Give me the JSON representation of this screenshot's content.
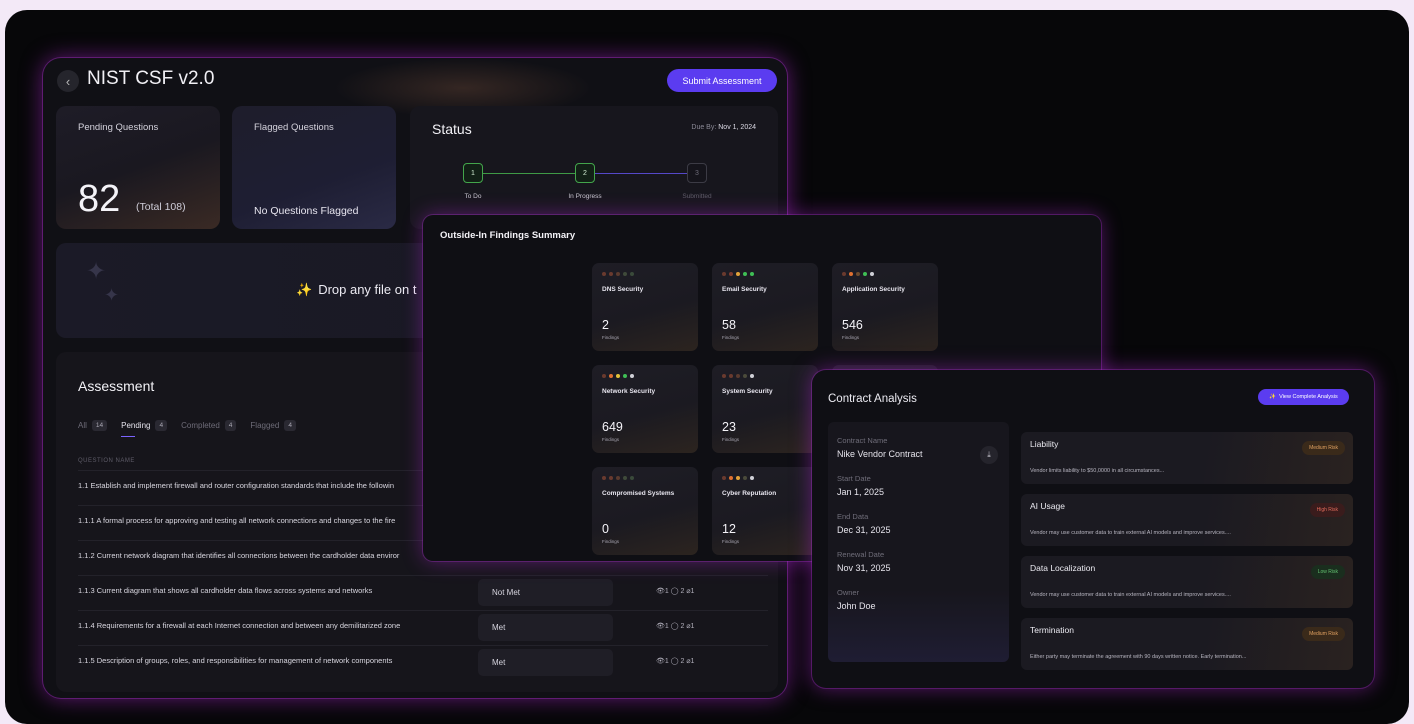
{
  "nist": {
    "title": "NIST CSF v2.0",
    "submit_label": "Submit Assessment",
    "pending": {
      "label": "Pending Questions",
      "value": "82",
      "total": "(Total 108)"
    },
    "flagged": {
      "label": "Flagged Questions",
      "text": "No Questions Flagged"
    },
    "status": {
      "title": "Status",
      "due_label": "Due By:",
      "due_date": "Nov 1, 2024",
      "steps": [
        {
          "num": "1",
          "label": "To Do"
        },
        {
          "num": "2",
          "label": "In Progress"
        },
        {
          "num": "3",
          "label": "Submitted"
        }
      ]
    },
    "drop_text": "Drop any file on t",
    "assessment": {
      "title": "Assessment",
      "tabs": [
        {
          "label": "All",
          "count": "14"
        },
        {
          "label": "Pending",
          "count": "4"
        },
        {
          "label": "Completed",
          "count": "4"
        },
        {
          "label": "Flagged",
          "count": "4"
        }
      ],
      "column_header": "QUESTION NAME",
      "rows": [
        {
          "question": "1.1 Establish and implement firewall and router configuration standards that include the followin",
          "status": "",
          "meta": ""
        },
        {
          "question": "1.1.1 A formal process for approving and testing all network connections and changes to the fire",
          "status": "",
          "meta": ""
        },
        {
          "question": "1.1.2 Current network diagram that identifies all connections between the cardholder data enviror",
          "status": "",
          "meta": ""
        },
        {
          "question": "1.1.3 Current diagram that shows all cardholder data flows across systems and networks",
          "status": "Not Met",
          "meta": "👁1  ◯ 2  ⌀1"
        },
        {
          "question": "1.1.4 Requirements for a firewall at each Internet connection and between any demilitarized zone",
          "status": "Met",
          "meta": "👁1  ◯ 2  ⌀1"
        },
        {
          "question": "1.1.5 Description of groups, roles, and responsibilities for management of network components",
          "status": "Met",
          "meta": "👁1  ◯ 2  ⌀1"
        }
      ]
    }
  },
  "findings": {
    "title": "Outside-In Findings Summary",
    "unit": "Findings",
    "cards": [
      {
        "name": "DNS Security",
        "value": "2",
        "dots": [
          "#6a3a2e",
          "#6a3a2e",
          "#5a3a2e",
          "#3f4a3a",
          "#3a4a3a"
        ]
      },
      {
        "name": "Email Security",
        "value": "58",
        "dots": [
          "#6a3a2e",
          "#7a3a30",
          "#e2a23a",
          "#3fbf55",
          "#3fbf55"
        ]
      },
      {
        "name": "Application Security",
        "value": "546",
        "dots": [
          "#6a3a2e",
          "#e07030",
          "#6a4a2e",
          "#3fbf55",
          "#cfcfd6"
        ]
      },
      {
        "name": "Network Security",
        "value": "649",
        "dots": [
          "#6a3a2e",
          "#e07030",
          "#e2c23a",
          "#3fbf55",
          "#cfcfd6"
        ]
      },
      {
        "name": "System Security",
        "value": "23",
        "dots": [
          "#6a3a2e",
          "#6a3a2e",
          "#5a3a2e",
          "#4a4a3a",
          "#cfcfd6"
        ]
      },
      {
        "name": "",
        "value": "",
        "dots": [
          "#5a2a40",
          "#5a2a40",
          "#4a2a3a",
          "#3a2a3a",
          "#3a2a3a"
        ]
      },
      {
        "name": "Compromised Systems",
        "value": "0",
        "dots": [
          "#6a3a2e",
          "#6a3a2e",
          "#5a3a2e",
          "#3f4a3a",
          "#3a4a3a"
        ]
      },
      {
        "name": "Cyber Reputation",
        "value": "12",
        "dots": [
          "#6a3a2e",
          "#e07030",
          "#e2a23a",
          "#4a4a3a",
          "#cfcfd6"
        ]
      }
    ]
  },
  "contract": {
    "title": "Contract Analysis",
    "view_button": "View Complete Analysis",
    "fields": [
      {
        "label": "Contract Name",
        "value": "Nike Vendor Contract"
      },
      {
        "label": "Start Date",
        "value": "Jan 1, 2025"
      },
      {
        "label": "End Data",
        "value": "Dec 31, 2025"
      },
      {
        "label": "Renewal Date",
        "value": "Nov 31, 2025"
      },
      {
        "label": "Owner",
        "value": "John Doe"
      }
    ],
    "clauses": [
      {
        "title": "Liability",
        "risk": "Medium Risk",
        "text": "Vendor limits liability to $50,0000 in all circumstances..."
      },
      {
        "title": "AI Usage",
        "risk": "High Risk",
        "text": "Vendor may use customer data to train external AI models and improve services...."
      },
      {
        "title": "Data Localization",
        "risk": "Low Risk",
        "text": "Vendor may use customer data to train external AI models and improve services...."
      },
      {
        "title": "Termination",
        "risk": "Medium Risk",
        "text": "Either party may terminate the agreement with 90 days written notice. Early termination..."
      }
    ]
  }
}
